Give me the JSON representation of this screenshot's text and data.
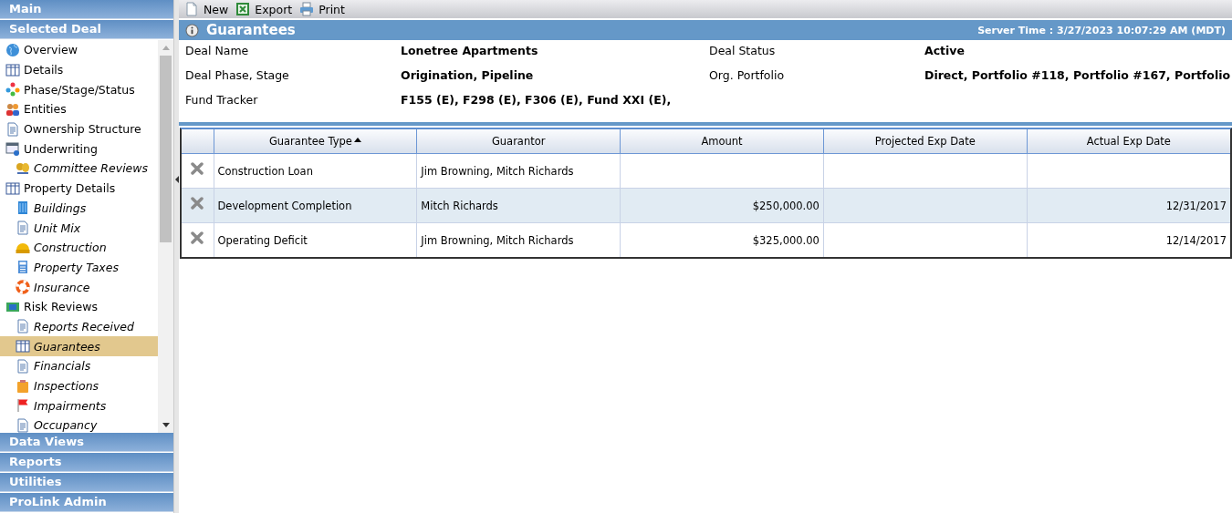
{
  "sidebar": {
    "panels_top": [
      {
        "title": "Main"
      },
      {
        "title": "Selected Deal"
      }
    ],
    "nav": [
      {
        "label": "Overview",
        "selected": false
      },
      {
        "label": "Details",
        "selected": false
      },
      {
        "label": "Phase/Stage/Status",
        "selected": false
      },
      {
        "label": "Entities",
        "selected": false
      },
      {
        "label": "Ownership Structure",
        "selected": false
      },
      {
        "label": "Underwriting",
        "selected": false,
        "children": [
          {
            "label": "Committee Reviews",
            "selected": false
          }
        ]
      },
      {
        "label": "Property Details",
        "selected": false,
        "children": [
          {
            "label": "Buildings",
            "selected": false
          },
          {
            "label": "Unit Mix",
            "selected": false
          },
          {
            "label": "Construction",
            "selected": false
          },
          {
            "label": "Property Taxes",
            "selected": false
          },
          {
            "label": "Insurance",
            "selected": false
          }
        ]
      },
      {
        "label": "Risk Reviews",
        "selected": false,
        "children": [
          {
            "label": "Reports Received",
            "selected": false
          },
          {
            "label": "Guarantees",
            "selected": true
          },
          {
            "label": "Financials",
            "selected": false
          },
          {
            "label": "Inspections",
            "selected": false
          },
          {
            "label": "Impairments",
            "selected": false
          },
          {
            "label": "Occupancy",
            "selected": false
          }
        ]
      }
    ],
    "panels_bottom": [
      {
        "title": "Data Views"
      },
      {
        "title": "Reports"
      },
      {
        "title": "Utilities"
      },
      {
        "title": "ProLink Admin"
      }
    ]
  },
  "toolbar": [
    {
      "label": "New"
    },
    {
      "label": "Export"
    },
    {
      "label": "Print"
    }
  ],
  "page_title": "Guarantees",
  "server_time": "Server Time : 3/27/2023 10:07:29 AM (MDT)",
  "info": [
    {
      "label": "Deal Name",
      "value": "Lonetree Apartments"
    },
    {
      "label": "Deal Status",
      "value": "Active"
    },
    {
      "label": "Deal Phase, Stage",
      "value": "Origination, Pipeline"
    },
    {
      "label": "Org. Portfolio",
      "value": "Direct, Portfolio #118, Portfolio #167, Portfolio"
    },
    {
      "label": "Fund Tracker",
      "value": "F155 (E), F298 (E), F306 (E), Fund XXI (E),"
    }
  ],
  "table": {
    "columns": [
      {
        "title": "Guarantee Type",
        "sorted": true
      },
      {
        "title": "Guarantor",
        "sorted": false
      },
      {
        "title": "Amount",
        "sorted": false
      },
      {
        "title": "Projected Exp Date",
        "sorted": false
      },
      {
        "title": "Actual Exp Date",
        "sorted": false
      }
    ],
    "rows": [
      {
        "guarantee_type": "Construction Loan",
        "guarantor": "Jim Browning, Mitch Richards"
      },
      {
        "guarantee_type": "Development Completion",
        "guarantor": "Mitch Richards",
        "amount": "$250,000.00",
        "actual_exp_date": "12/31/2017"
      },
      {
        "guarantee_type": "Operating Deficit",
        "guarantor": "Jim Browning, Mitch Richards",
        "amount": "$325,000.00",
        "actual_exp_date": "12/14/2017"
      }
    ]
  }
}
